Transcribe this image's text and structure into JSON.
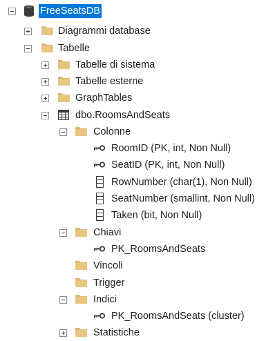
{
  "tree": {
    "root": {
      "label": "FreeSeatsDB",
      "state": "expanded",
      "icon": "database-icon",
      "selected": true
    },
    "nodes": [
      {
        "label": "Diagrammi database",
        "state": "collapsed",
        "icon": "folder-icon"
      },
      {
        "label": "Tabelle",
        "state": "expanded",
        "icon": "folder-icon"
      },
      {
        "label": "Tabelle di sistema",
        "state": "collapsed",
        "icon": "folder-icon"
      },
      {
        "label": "Tabelle esterne",
        "state": "collapsed",
        "icon": "folder-icon"
      },
      {
        "label": "GraphTables",
        "state": "collapsed",
        "icon": "folder-icon"
      },
      {
        "label": "dbo.RoomsAndSeats",
        "state": "expanded",
        "icon": "table-icon"
      },
      {
        "label": "Colonne",
        "state": "expanded",
        "icon": "folder-icon"
      },
      {
        "label": "RoomID (PK, int, Non Null)",
        "icon": "primary-key-icon"
      },
      {
        "label": "SeatID (PK, int, Non Null)",
        "icon": "primary-key-icon"
      },
      {
        "label": "RowNumber (char(1), Non Null)",
        "icon": "column-icon"
      },
      {
        "label": "SeatNumber (smallint, Non Null)",
        "icon": "column-icon"
      },
      {
        "label": "Taken (bit, Non Null)",
        "icon": "column-icon"
      },
      {
        "label": "Chiavi",
        "state": "expanded",
        "icon": "folder-icon"
      },
      {
        "label": "PK_RoomsAndSeats",
        "icon": "primary-key-icon"
      },
      {
        "label": "Vincoli",
        "icon": "folder-icon"
      },
      {
        "label": "Trigger",
        "icon": "folder-icon"
      },
      {
        "label": "Indici",
        "state": "expanded",
        "icon": "folder-icon"
      },
      {
        "label": "PK_RoomsAndSeats (cluster)",
        "icon": "index-key-icon"
      },
      {
        "label": "Statistiche",
        "state": "collapsed",
        "icon": "folder-icon"
      }
    ]
  },
  "colors": {
    "selection": "#0078d7",
    "folder": "#dcb67a",
    "database": "#3c3c3c",
    "text": "#1e1e1e"
  }
}
